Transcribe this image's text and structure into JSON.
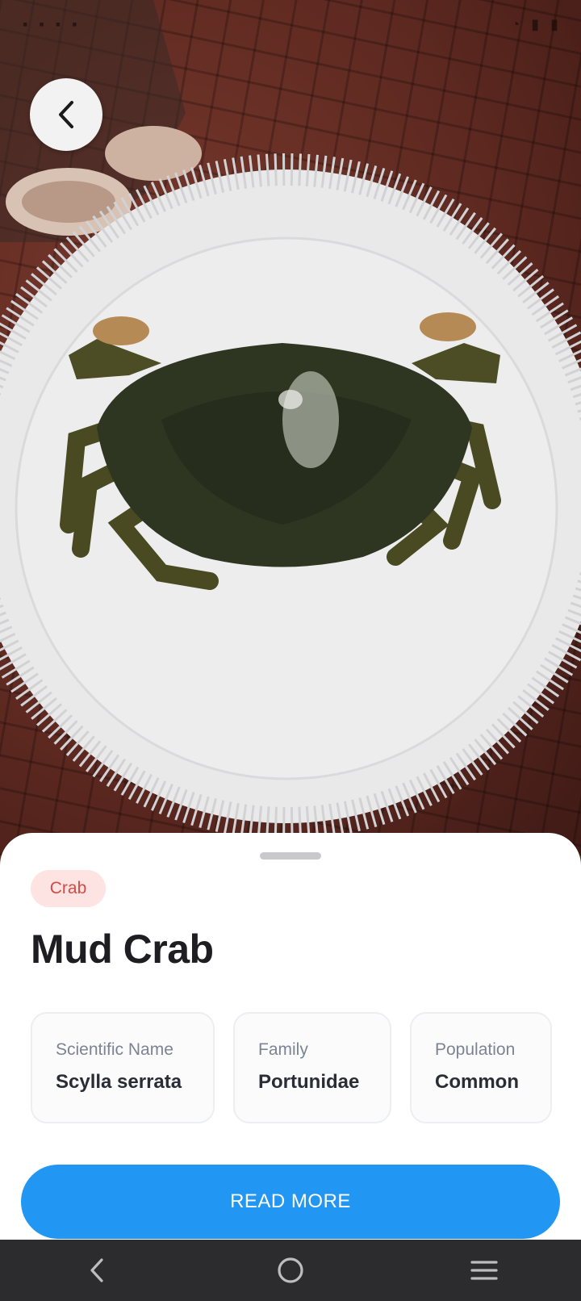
{
  "species": {
    "category": "Crab",
    "name": "Mud Crab",
    "info": [
      {
        "label": "Scientific Name",
        "value": "Scylla serrata"
      },
      {
        "label": "Family",
        "value": "Portunidae"
      },
      {
        "label": "Population",
        "value": "Common"
      }
    ]
  },
  "actions": {
    "read_more_label": "READ MORE"
  },
  "hero": {
    "photo_subject": "mud crab on white foam plate"
  },
  "colors": {
    "accent": "#2196f3",
    "badge_bg": "#fde3e1",
    "badge_text": "#d24b45",
    "title_text": "#1d1d22"
  },
  "icons": {
    "back": "chevron-left-icon",
    "nav_back": "nav-back-icon",
    "nav_home": "nav-home-icon",
    "nav_recents": "nav-recents-icon"
  }
}
